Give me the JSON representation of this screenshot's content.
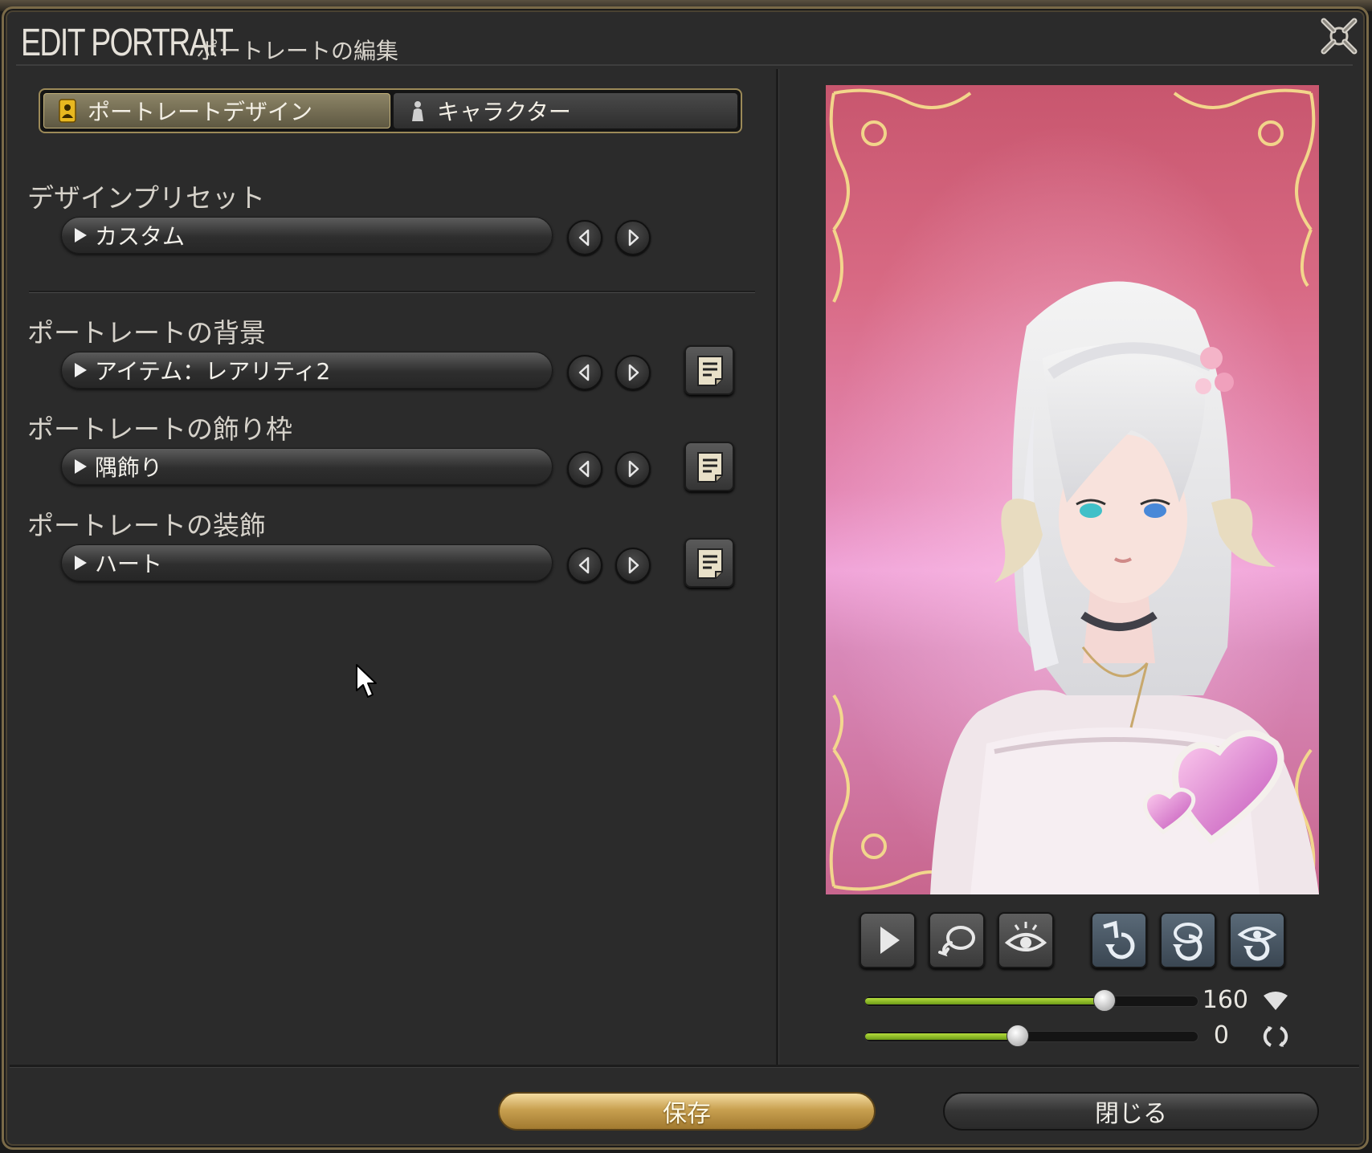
{
  "window": {
    "title_en": "EDIT PORTRAIT",
    "title_jp": "ポートレートの編集"
  },
  "tabs": [
    {
      "label": "ポートレートデザイン",
      "active": true,
      "icon": "portrait-design-icon"
    },
    {
      "label": "キャラクター",
      "active": false,
      "icon": "character-icon"
    }
  ],
  "design_preset": {
    "title": "デザインプリセット",
    "value": "カスタム"
  },
  "background": {
    "title": "ポートレートの背景",
    "value": "アイテム：レアリティ2"
  },
  "frame": {
    "title": "ポートレートの飾り枠",
    "value": "隅飾り"
  },
  "decoration": {
    "title": "ポートレートの装飾",
    "value": "ハート"
  },
  "portrait_controls": [
    {
      "icon": "play-icon"
    },
    {
      "icon": "expression-icon"
    },
    {
      "icon": "eye-icon"
    },
    {
      "icon": "reset-pose-icon"
    },
    {
      "icon": "reset-head-icon"
    },
    {
      "icon": "reset-gaze-icon"
    }
  ],
  "sliders": [
    {
      "value": "160",
      "fraction": 0.72,
      "icon": "lighting-icon"
    },
    {
      "value": "0",
      "fraction": 0.46,
      "icon": "rotate-icon"
    }
  ],
  "footer": {
    "save_label": "保存",
    "close_label": "閉じる"
  },
  "colors": {
    "accent_gold": "#c8a050",
    "slider_green": "#9cc82c",
    "window_border": "#7a6a48"
  }
}
